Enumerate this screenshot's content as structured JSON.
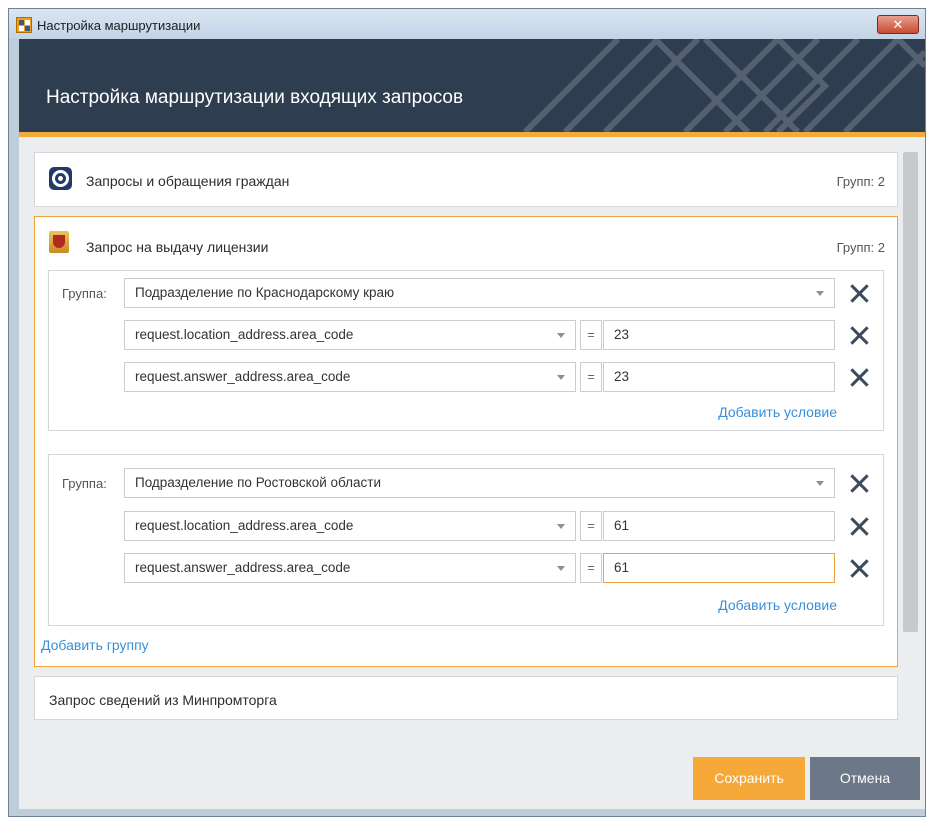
{
  "window": {
    "title": "Настройка маршрутизации",
    "close_label": "✕"
  },
  "header": {
    "title": "Настройка маршрутизации входящих запросов"
  },
  "cards": [
    {
      "title": "Запросы и обращения граждан",
      "count": "Групп: 2"
    },
    {
      "title": "Запрос на выдачу лицензии",
      "count": "Групп: 2",
      "groups": [
        {
          "label": "Группа:",
          "name": "Подразделение по Краснодарскому краю",
          "conditions": [
            {
              "field": "request.location_address.area_code",
              "op": "=",
              "value": "23"
            },
            {
              "field": "request.answer_address.area_code",
              "op": "=",
              "value": "23"
            }
          ],
          "add_condition": "Добавить условие"
        },
        {
          "label": "Группа:",
          "name": "Подразделение по Ростовской области",
          "conditions": [
            {
              "field": "request.location_address.area_code",
              "op": "=",
              "value": "61"
            },
            {
              "field": "request.answer_address.area_code",
              "op": "=",
              "value": "61"
            }
          ],
          "add_condition": "Добавить условие"
        }
      ],
      "add_group": "Добавить группу"
    },
    {
      "title": "Запрос сведений из Минпромторга"
    }
  ],
  "footer": {
    "save_label": "Сохранить",
    "cancel_label": "Отмена"
  },
  "colors": {
    "header_bg": "#2f3d51",
    "accent": "#f4a93b",
    "link": "#3a8fd8",
    "cancel_bg": "#6c7887"
  },
  "icons": {
    "close": "close-icon",
    "requests": "target-circle-icon",
    "license": "coat-of-arms-icon",
    "remove": "remove-x-icon",
    "dropdown": "chevron-down-icon"
  }
}
